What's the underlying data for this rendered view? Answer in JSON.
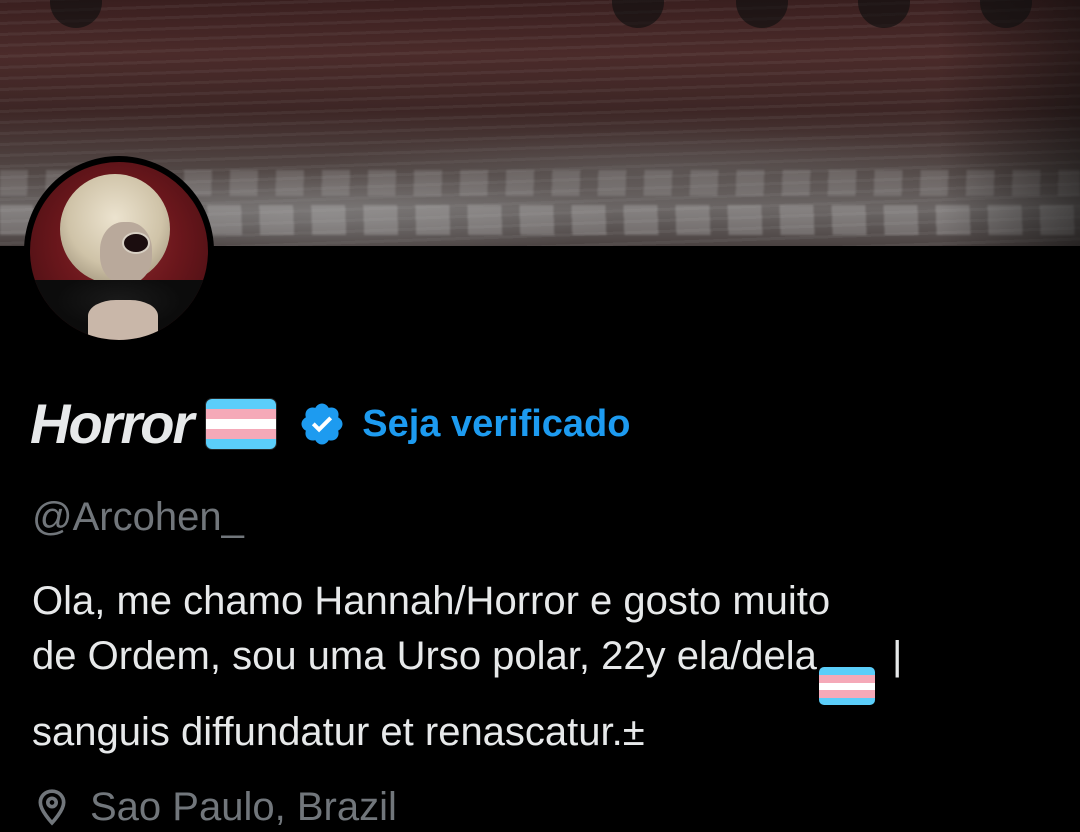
{
  "profile": {
    "display_name": "Horror",
    "flag_icon": "transgender-flag-icon",
    "verified_icon": "verified-badge-icon",
    "verify_link": "Seja verificado",
    "handle": "@Arcohen_",
    "bio": {
      "line1": "Ola, me chamo Hannah/Horror e gosto muito",
      "line2_before_flag": "de Ordem, sou uma Urso polar, 22y ela/dela",
      "line2_after_flag": " |",
      "line3": "sanguis diffundatur et renascatur.±"
    },
    "location": "Sao Paulo, Brazil",
    "location_icon": "location-pin-icon"
  },
  "colors": {
    "background": "#000000",
    "text_primary": "#e7e9ea",
    "text_secondary": "#71767b",
    "accent": "#1d9bf0",
    "flag_blue": "#5bcefa",
    "flag_pink": "#f5a9b8",
    "flag_white": "#ffffff"
  }
}
